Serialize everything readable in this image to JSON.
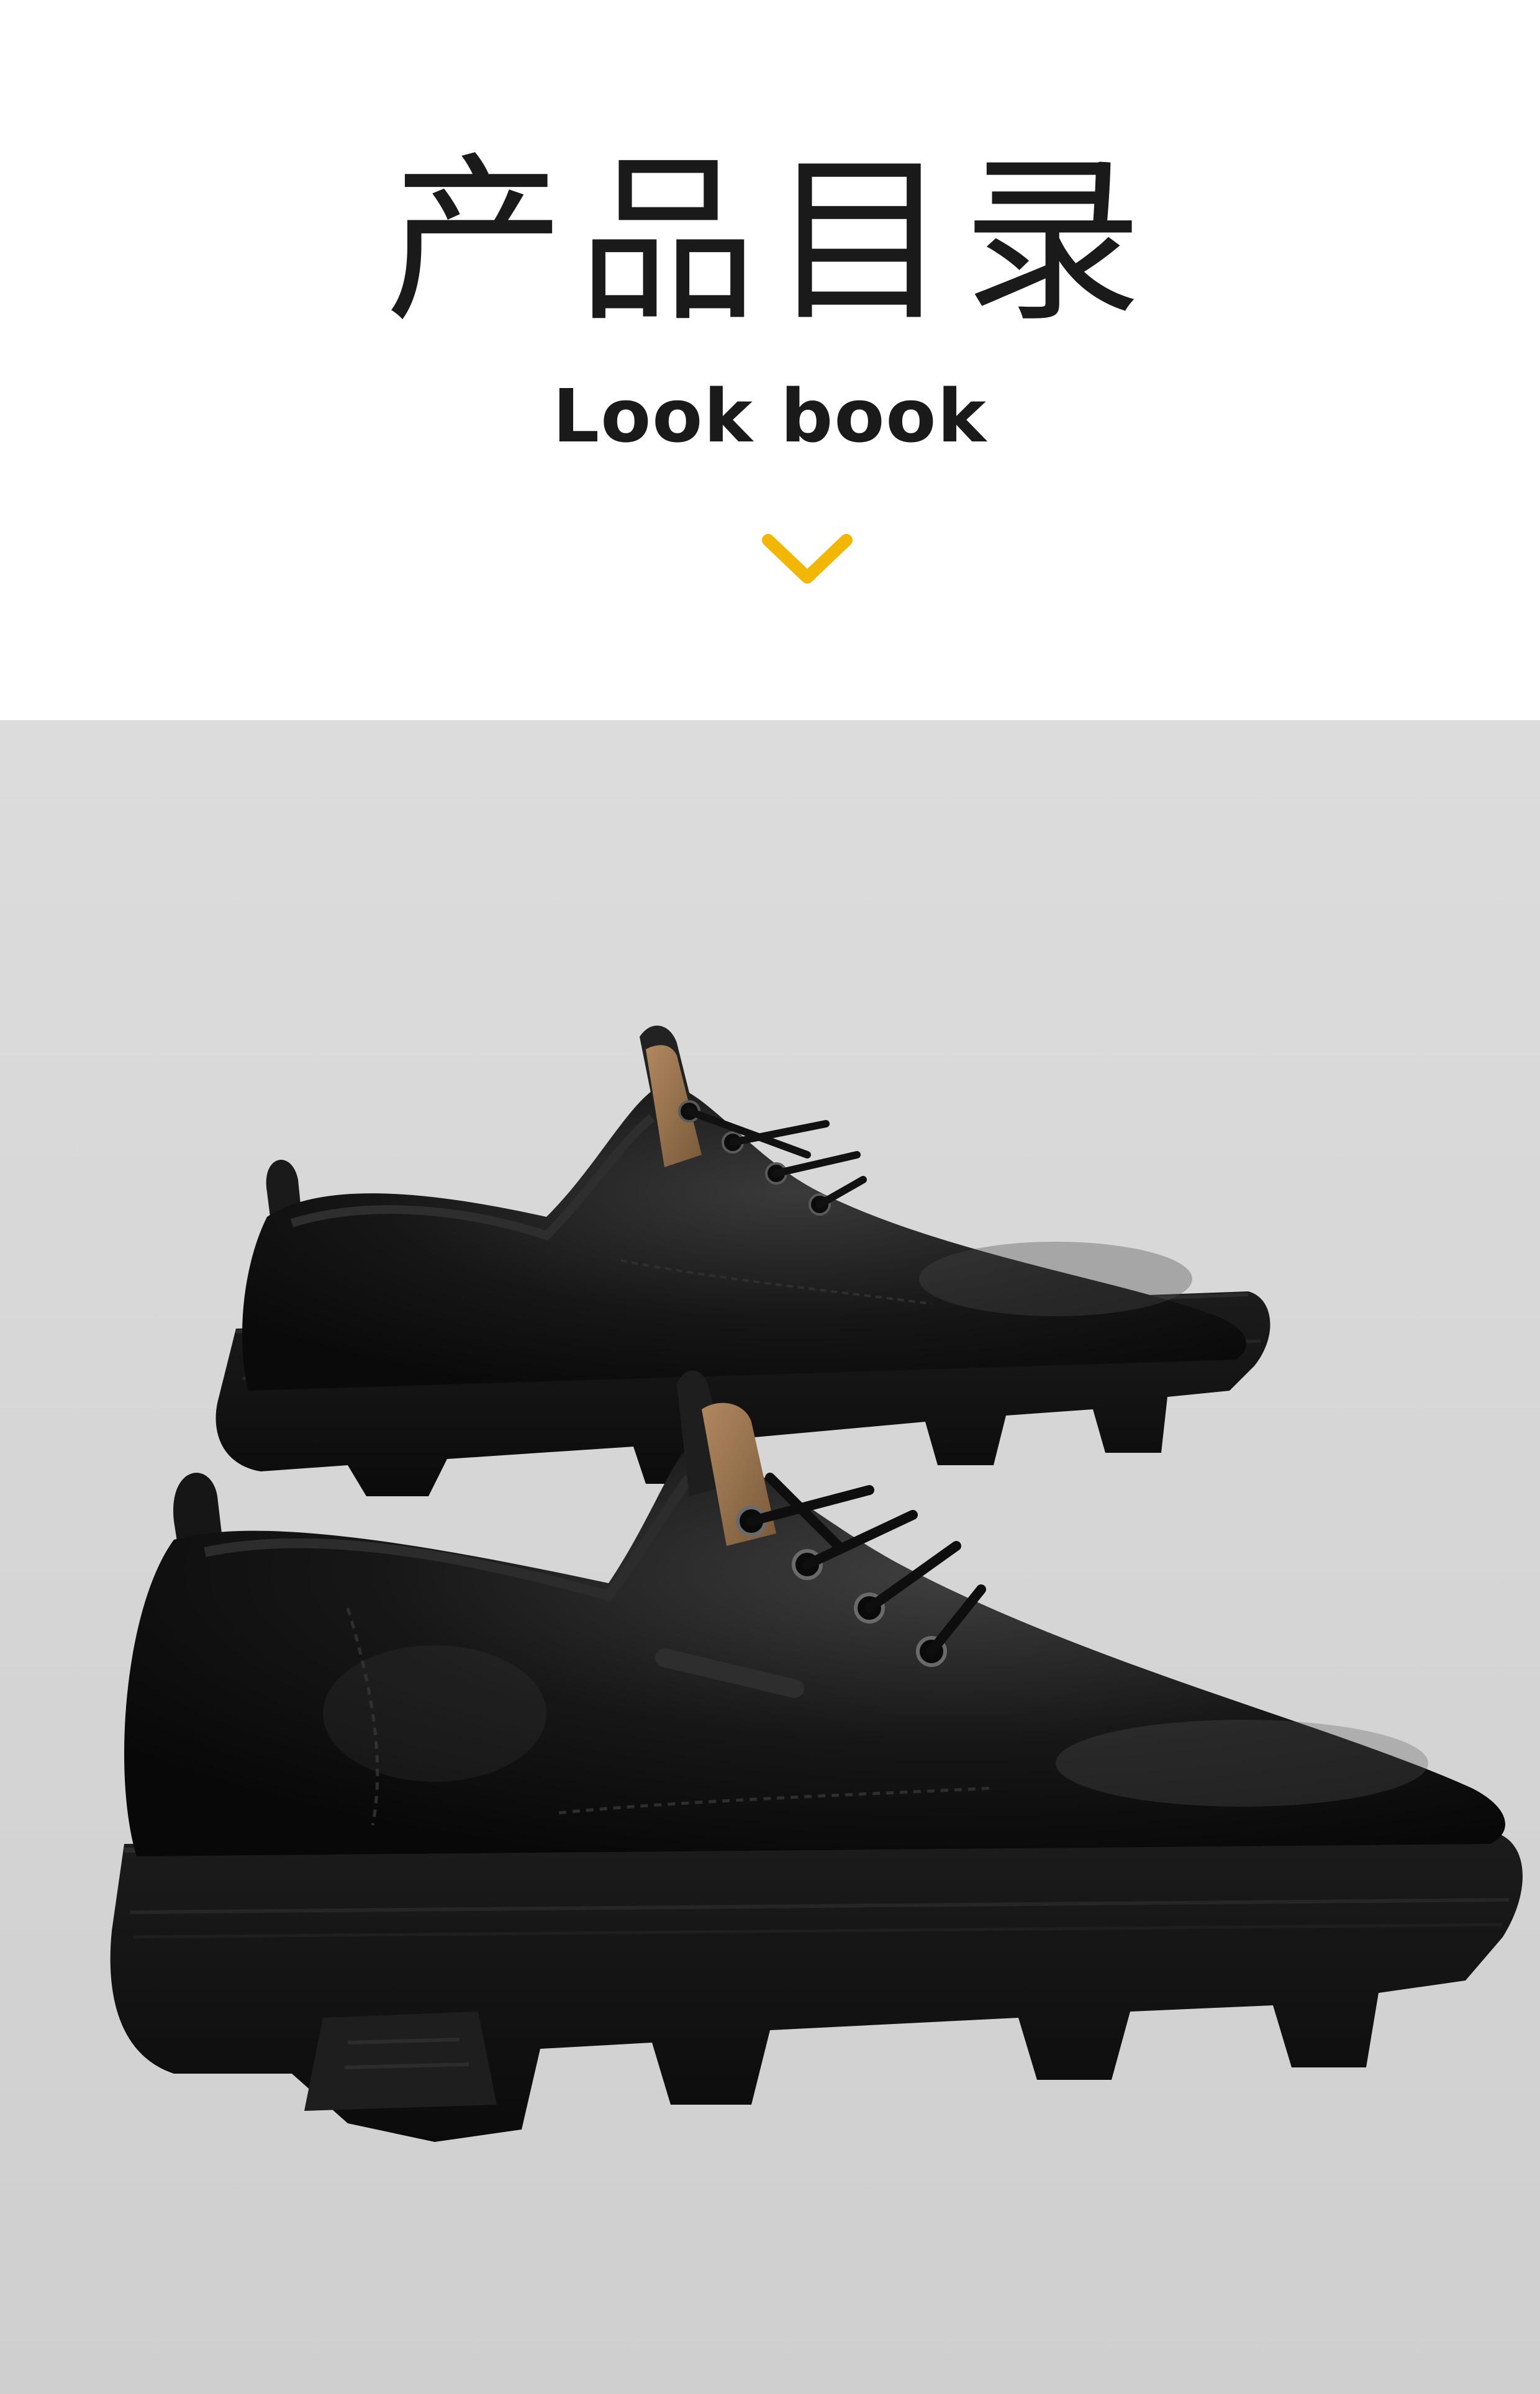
{
  "header": {
    "title_cn": "产品目录",
    "title_en": "Look book",
    "chevron_icon": "chevron-down-icon",
    "accent_color": "#f2b705"
  },
  "photo": {
    "background_color": "#d9d9d9",
    "subject": "shoes"
  }
}
